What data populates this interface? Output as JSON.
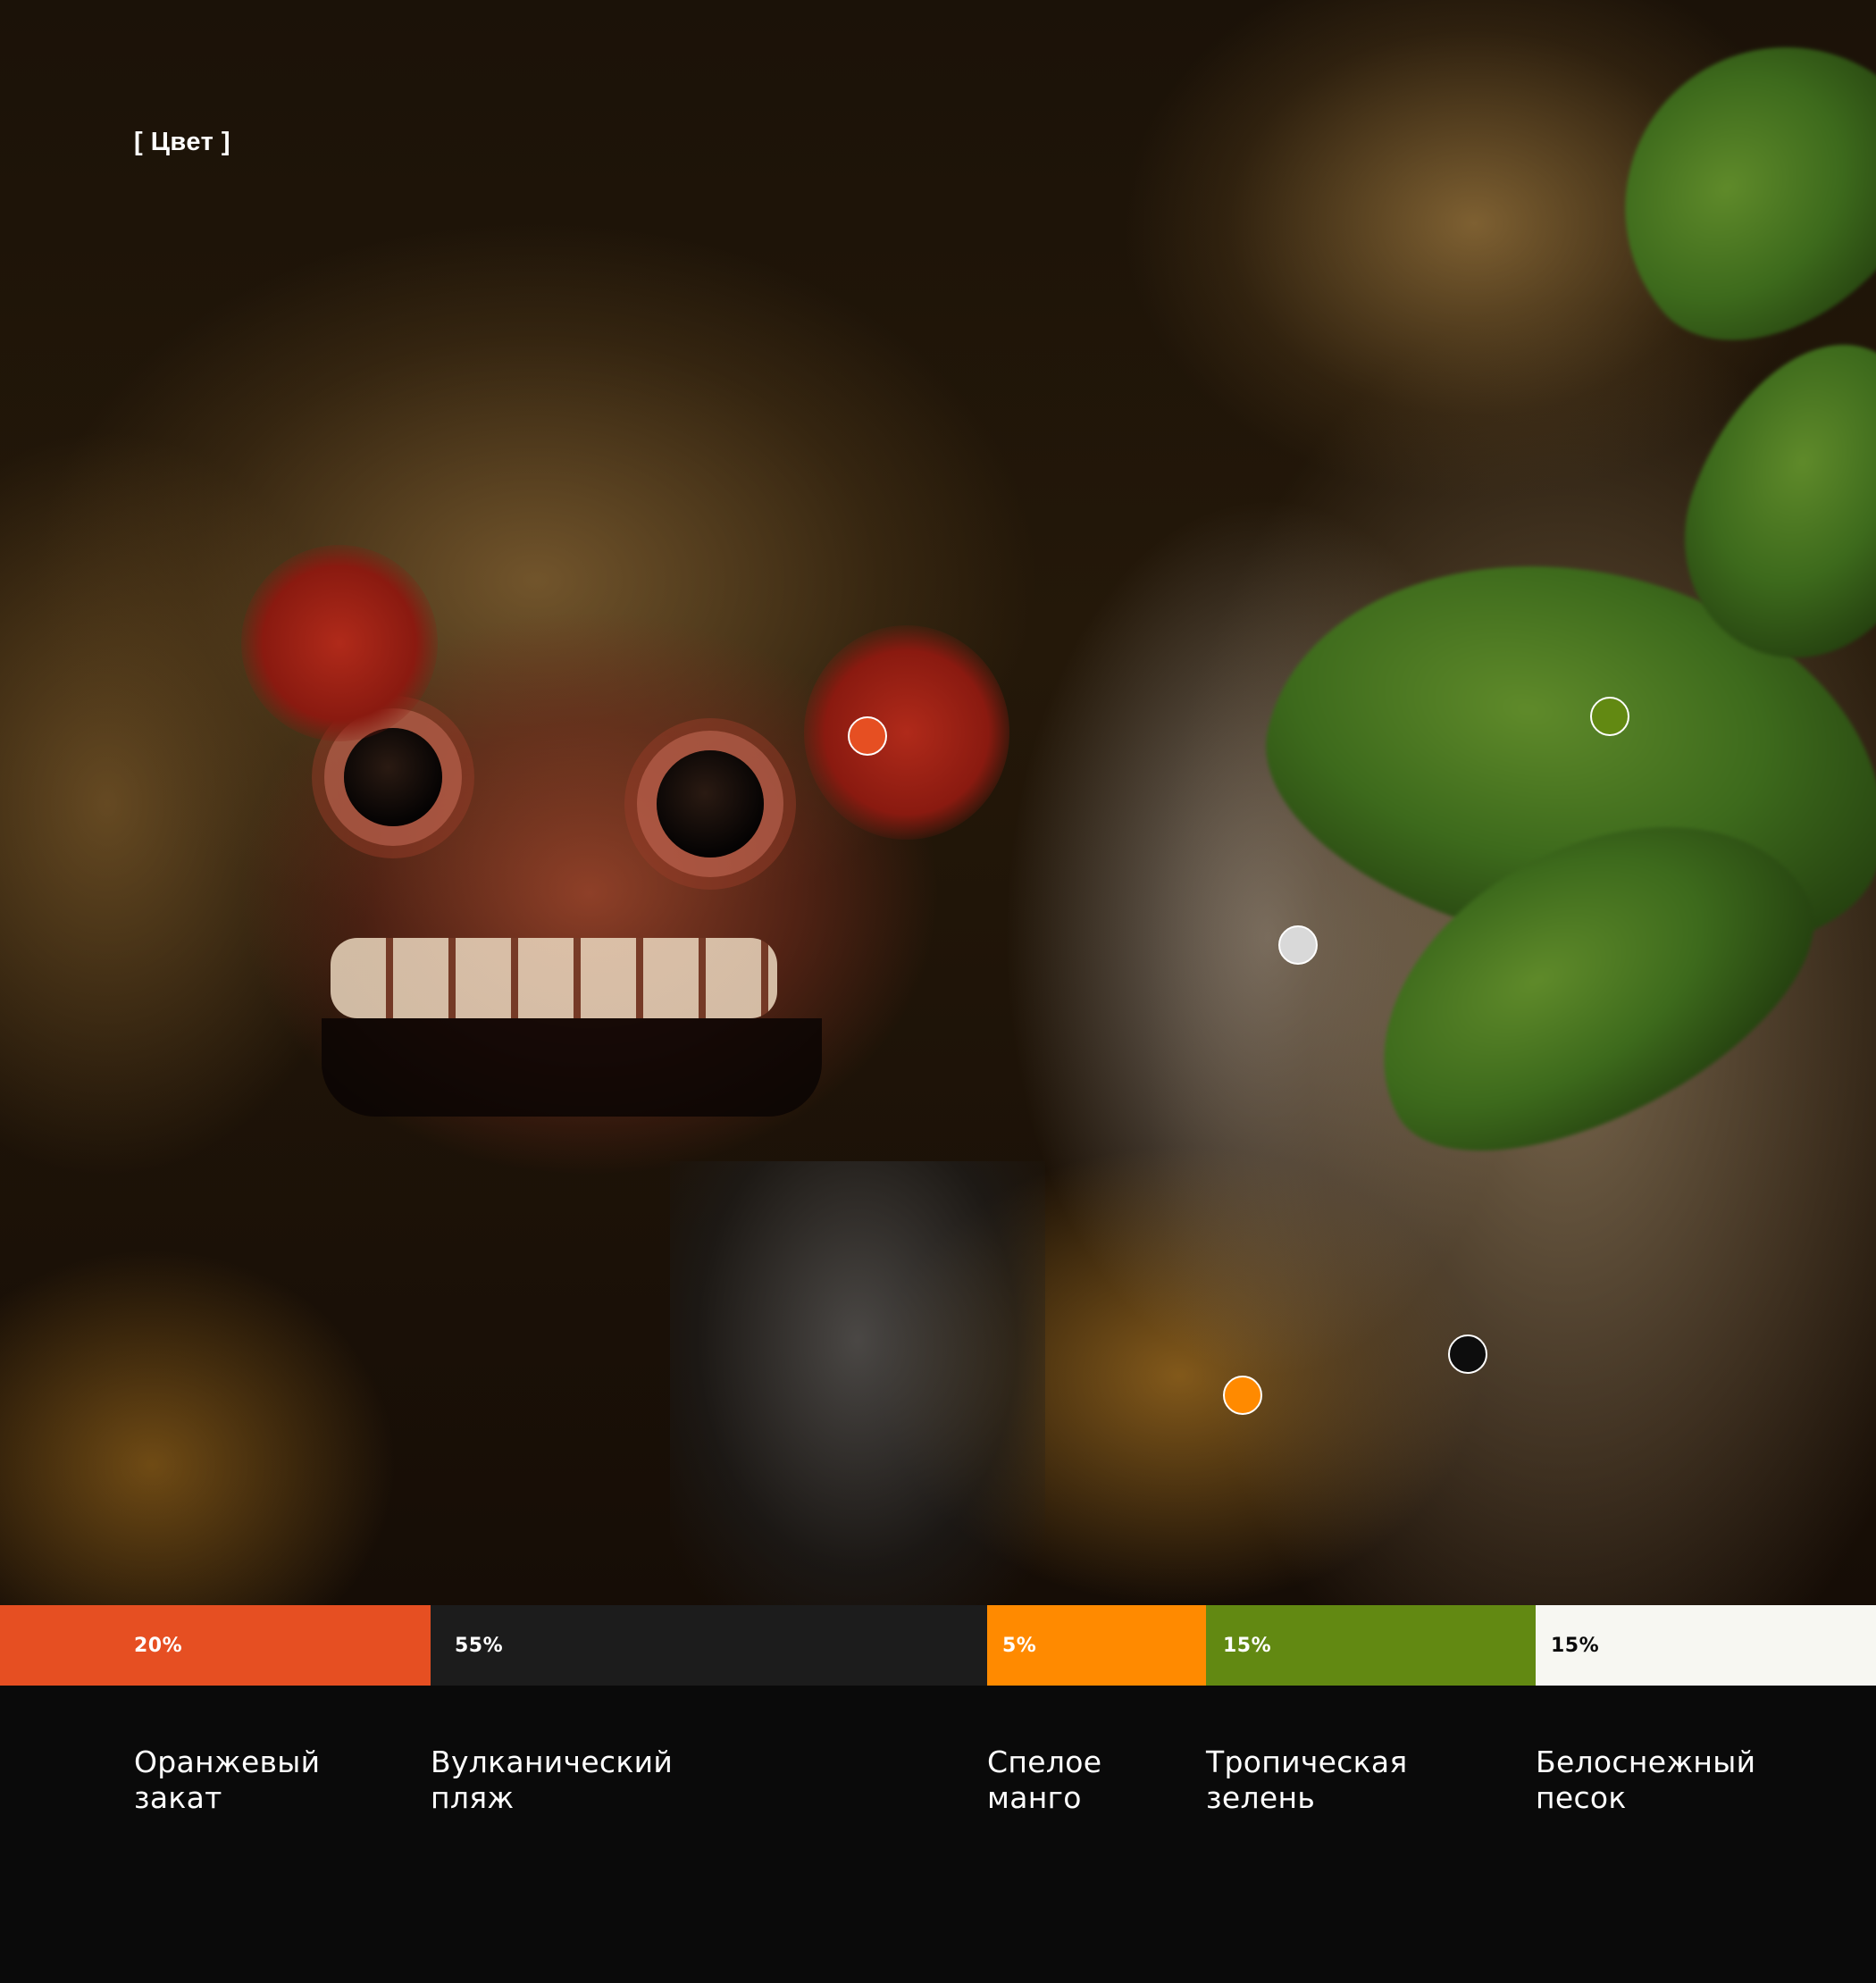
{
  "section_label": "[ Цвет ]",
  "colors": {
    "orange": "#e64f22",
    "dark": "#1c1c1c",
    "mango": "#ff8a00",
    "green": "#628912",
    "white": "#f7f7f2",
    "background": "#0a0a0a",
    "marker_white": "#d9d9d9",
    "marker_black": "#0d0d0d"
  },
  "palette": [
    {
      "percent": "20%",
      "share": 20,
      "name": "Оранжевый\nзакат",
      "color": "#e64f22",
      "text_color": "#ffffff"
    },
    {
      "percent": "55%",
      "share": 55,
      "name": "Вулканический\nпляж",
      "color": "#1c1c1c",
      "text_color": "#ffffff"
    },
    {
      "percent": "5%",
      "share": 5,
      "name": "Спелое\nманго",
      "color": "#ff8a00",
      "text_color": "#ffffff"
    },
    {
      "percent": "15%",
      "share": 15,
      "name": "Тропическая\nзелень",
      "color": "#628912",
      "text_color": "#ffffff"
    },
    {
      "percent": "15%",
      "share": 15,
      "name": "Белоснежный\nпесок",
      "color": "#f7f7f2",
      "text_color": "#0a0a0a"
    }
  ]
}
